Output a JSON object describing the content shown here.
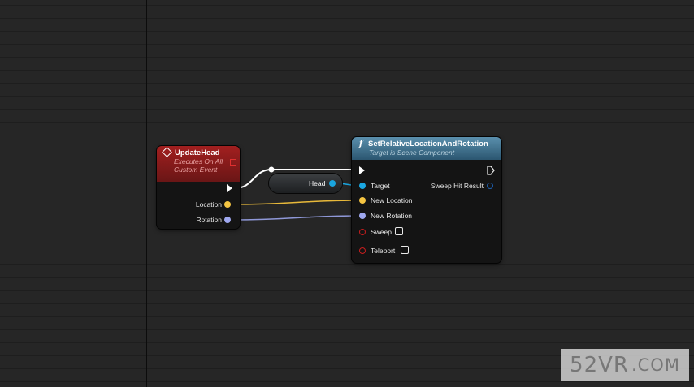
{
  "graph": {
    "event_node": {
      "title": "UpdateHead",
      "subtitle_line1": "Executes On All",
      "subtitle_line2": "Custom Event",
      "pins": [
        "Location",
        "Rotation"
      ]
    },
    "variable_node": {
      "label": "Head"
    },
    "function_node": {
      "title": "SetRelativeLocationAndRotation",
      "subtitle": "Target is Scene Component",
      "input_pins": [
        "Target",
        "New Location",
        "New Rotation",
        "Sweep",
        "Teleport"
      ],
      "output_pins": [
        "Sweep Hit Result"
      ],
      "sweep_checked": false,
      "teleport_checked": false
    }
  },
  "colors": {
    "vector_pin": "#f5c542",
    "rotator_pin": "#9fa8f0",
    "object_pin": "#1aa6e0",
    "bool_pin": "#c81e1e",
    "struct_pin": "#1e5fb0",
    "exec_wire": "#ffffff"
  },
  "watermark": {
    "main": "52VR",
    "suffix": ".COM"
  }
}
